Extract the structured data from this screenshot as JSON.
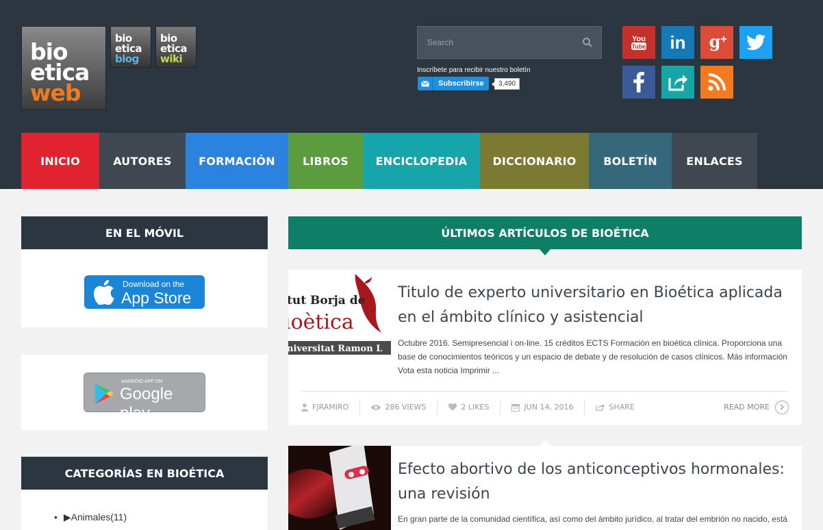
{
  "logos": {
    "main": [
      "bio",
      "etica",
      "web"
    ],
    "blog": [
      "bio",
      "etica",
      "blog"
    ],
    "wiki": [
      "bio",
      "etica",
      "wiki"
    ]
  },
  "search": {
    "placeholder": "Search"
  },
  "subscribe": {
    "text": "Inscríbete para recibir nuestro boletín",
    "button": "Subscribirse",
    "count": "3,490"
  },
  "social": [
    {
      "name": "youtube-icon",
      "label": "You Tube",
      "color": "#c5302a"
    },
    {
      "name": "linkedin-icon",
      "label": "in",
      "color": "#1479b6"
    },
    {
      "name": "google-plus-icon",
      "label": "g+",
      "color": "#dd4b39"
    },
    {
      "name": "twitter-icon",
      "label": "twitter",
      "color": "#1da1f2"
    },
    {
      "name": "facebook-icon",
      "label": "f",
      "color": "#3b5a98"
    },
    {
      "name": "share-icon",
      "label": "share",
      "color": "#17a5a6"
    },
    {
      "name": "rss-icon",
      "label": "rss",
      "color": "#f47a20"
    }
  ],
  "nav": [
    {
      "label": "INICIO",
      "color": "#e0232f"
    },
    {
      "label": "AUTORES",
      "color": "#3f4850"
    },
    {
      "label": "FORMACIÓN",
      "color": "#2c82df"
    },
    {
      "label": "LIBROS",
      "color": "#5b9c3f"
    },
    {
      "label": "ENCICLOPEDIA",
      "color": "#16a5aa"
    },
    {
      "label": "DICCIONARIO",
      "color": "#7b7932"
    },
    {
      "label": "BOLETÍN",
      "color": "#36687c"
    },
    {
      "label": "ENLACES",
      "color": "#3f4850"
    }
  ],
  "sidebar": {
    "mobile_title": "EN EL MÓVIL",
    "appstore_small": "Download on the",
    "appstore_big": "App Store",
    "googleplay_small": "ANDROID APP ON",
    "googleplay_big": "Google play",
    "categories_title": "CATEGORÍAS EN BIOÉTICA",
    "categories": [
      "▶Animales(11)"
    ]
  },
  "main": {
    "title": "ÚLTIMOS ARTÍCULOS DE BIOÉTICA",
    "articles": [
      {
        "image_text": [
          "tut Borja de",
          "ioètica",
          "niversitat Ramon L"
        ],
        "title": "Titulo de experto universitario en Bioética aplicada en el ámbito clínico y asistencial",
        "excerpt": "Octubre 2016. Semipresencial i on-line. 15 créditos ECTS Formación en bioética clínica. Proporciona una base de conocimientos teóricos y un espacio de debate y de resolución de casos clínicos. Más información Vota esta noticia Imprimir ...",
        "author": "FJRAMIRO",
        "views": "286 VIEWS",
        "likes": "2 LIKES",
        "date": "JUN 14, 2016",
        "share": "SHARE",
        "read_more": "READ MORE"
      },
      {
        "title": "Efecto abortivo de los anticonceptivos hormonales: una revisión",
        "excerpt": "En gran parte de la comunidad científica, así como del ámbito jurídico, al tratar del embrión no nacido, está"
      }
    ]
  }
}
